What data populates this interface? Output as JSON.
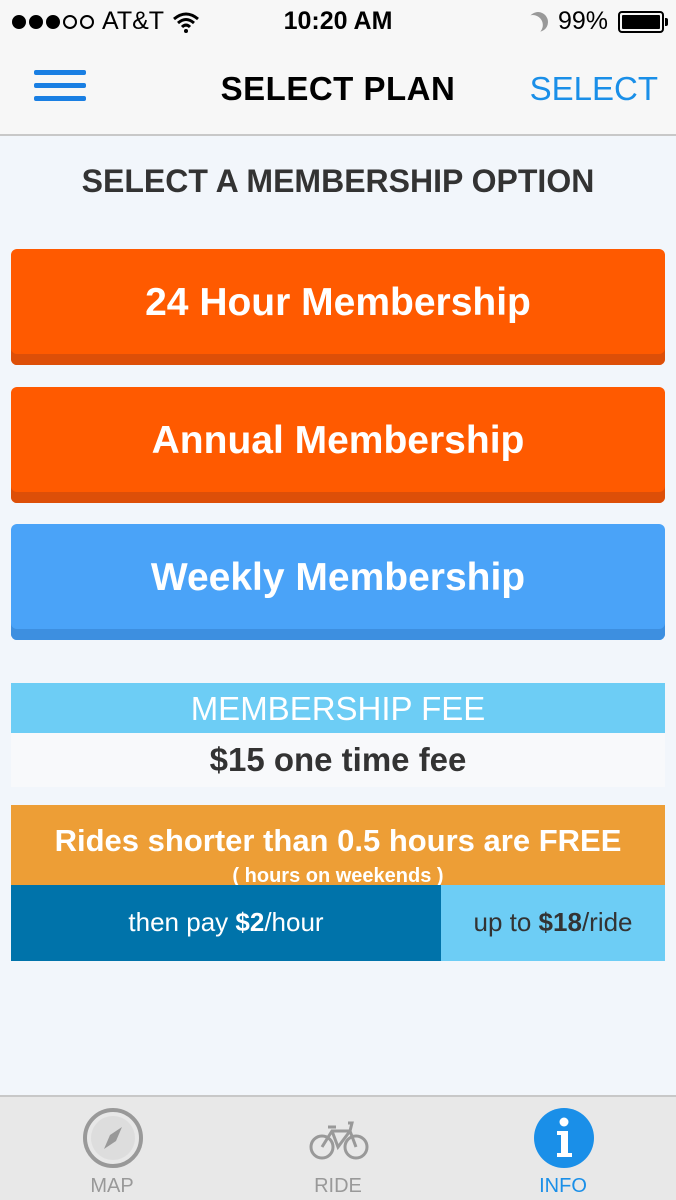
{
  "status": {
    "carrier": "AT&T",
    "time": "10:20 AM",
    "battery": "99%"
  },
  "nav": {
    "title": "SELECT PLAN",
    "select_label": "SELECT"
  },
  "section_title": "SELECT A MEMBERSHIP OPTION",
  "plans": [
    {
      "label": "24 Hour Membership",
      "color": "#ff5a00"
    },
    {
      "label": "Annual Membership",
      "color": "#ff5a00"
    },
    {
      "label": "Weekly Membership",
      "color": "#4aa3f8"
    }
  ],
  "fee": {
    "header": "MEMBERSHIP FEE",
    "value": "$15 one time fee"
  },
  "rides": {
    "free_text": "Rides shorter than 0.5 hours are FREE",
    "free_subtext": "( hours on weekends )",
    "pay_prefix": "then pay ",
    "pay_rate": "$2",
    "pay_suffix": "/hour",
    "cap_prefix": "up to ",
    "cap_amount": "$18",
    "cap_suffix": "/ride"
  },
  "tabs": [
    {
      "label": "MAP",
      "icon": "compass-icon",
      "active": false
    },
    {
      "label": "RIDE",
      "icon": "bike-icon",
      "active": false
    },
    {
      "label": "INFO",
      "icon": "info-icon",
      "active": true
    }
  ],
  "colors": {
    "accent": "#1a8fe8",
    "orange": "#ff5a00",
    "blue_button": "#4aa3f8",
    "fee_header": "#6dcdf5",
    "free_bar": "#ed9e36",
    "pay_bar": "#0073aa"
  }
}
